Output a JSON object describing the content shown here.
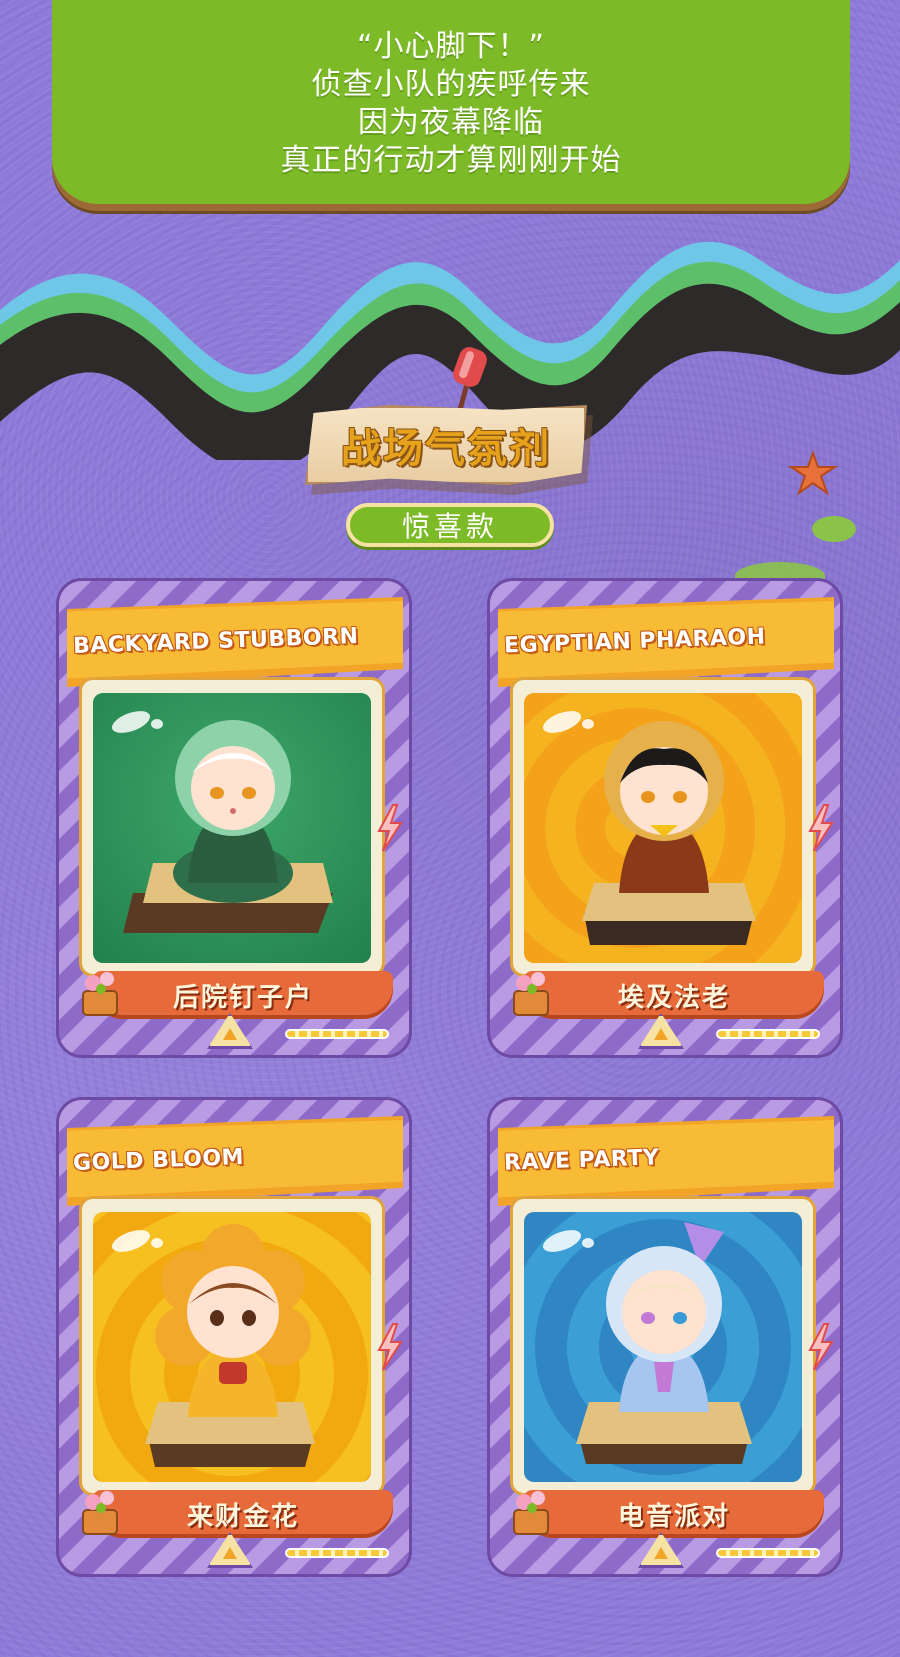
{
  "banner": {
    "lines": [
      "“小心脚下！”",
      "侦查小队的疾呼传来",
      "因为夜幕降临",
      "真正的行动才算刚刚开始"
    ]
  },
  "section": {
    "title": "战场气氛剂",
    "badge": "惊喜款"
  },
  "cards": [
    {
      "en": "BACKYARD STUBBORN",
      "zh": "后院钉子户",
      "bg": "green"
    },
    {
      "en": "EGYPTIAN PHARAOH",
      "zh": "埃及法老",
      "bg": "orange"
    },
    {
      "en": "GOLD BLOOM",
      "zh": "来财金花",
      "bg": "gold"
    },
    {
      "en": "RAVE PARTY",
      "zh": "电音派对",
      "bg": "blue"
    }
  ],
  "colors": {
    "background": "#8e7ad8",
    "banner": "#7cba28",
    "card_orange": "#f1a428",
    "name_bar": "#e76a3a"
  }
}
